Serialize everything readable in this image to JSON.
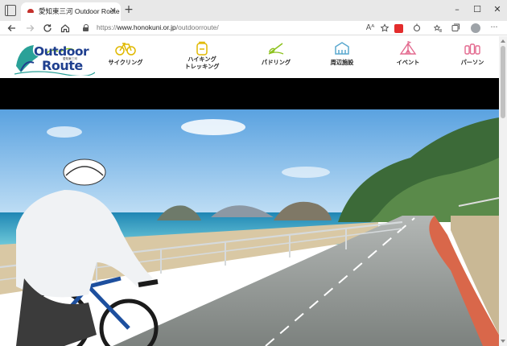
{
  "browser": {
    "tab_title": "愛知東三河 Outdoor Route",
    "tab_close": "×",
    "new_tab": "+",
    "url_scheme": "https://",
    "url_host": "www.honokuni.or.jp",
    "url_path": "/outdoorroute/",
    "controls": {
      "minimize": "–",
      "maximize": "☐",
      "close": "✕"
    },
    "read_aloud": "Aᴬ",
    "more": "···"
  },
  "logo": {
    "line1": "Outdoor",
    "line2": "Route",
    "sub": "愛知東三河"
  },
  "nav": {
    "items": [
      {
        "label": "サイクリング",
        "icon": "bicycle-icon"
      },
      {
        "label_top": "ハイキング",
        "label_bottom": "トレッキング",
        "icon": "backpack-icon"
      },
      {
        "label": "パドリング",
        "icon": "paddle-icon"
      },
      {
        "label": "周辺施設",
        "icon": "building-icon"
      },
      {
        "label": "イベント",
        "icon": "tent-icon"
      },
      {
        "label": "パーソン",
        "icon": "people-icon"
      }
    ]
  },
  "colors": {
    "nav_icon_green": "#8dc21f",
    "nav_icon_pink": "#e36a8f",
    "nav_icon_blue": "#5aa8cf",
    "nav_icon_yellow": "#e0b800",
    "logo_navy": "#1f3f8f",
    "logo_teal": "#2aa198"
  }
}
